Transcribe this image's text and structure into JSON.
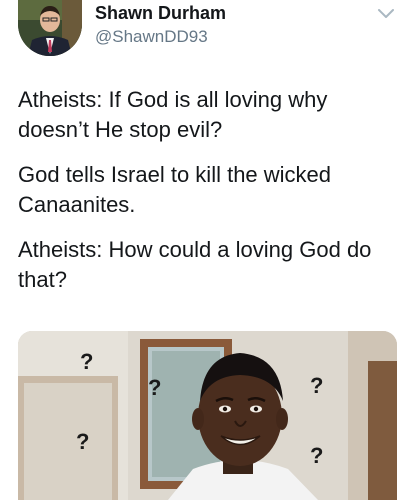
{
  "user": {
    "display_name": "Shawn Durham",
    "handle": "@ShawnDD93"
  },
  "icons": {
    "avatar": "avatar-photo",
    "menu": "chevron-down-icon"
  },
  "tweet": {
    "lines": [
      "Atheists: If God is all loving why doesn’t He stop evil?",
      "God tells Israel to kill the wicked Canaanites.",
      "Atheists: How could a loving God do that?"
    ]
  },
  "media": {
    "description_icon": "confused-meme-image",
    "question_marks": [
      "?",
      "?",
      "?",
      "?",
      "?"
    ]
  },
  "colors": {
    "text": "#14171a",
    "secondary": "#657786",
    "caret": "#aab8c2"
  }
}
